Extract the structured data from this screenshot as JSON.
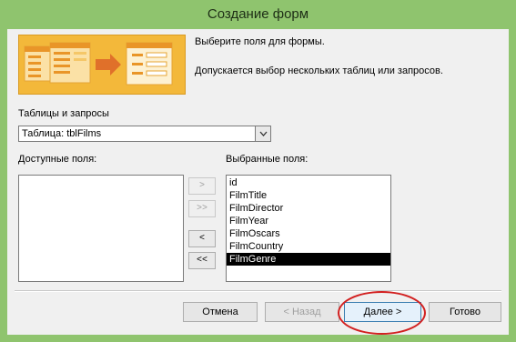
{
  "window": {
    "title": "Создание форм"
  },
  "intro": {
    "line1": "Выберите поля для формы.",
    "line2": "Допускается выбор нескольких таблиц или запросов."
  },
  "source": {
    "label": "Таблицы и запросы",
    "selected": "Таблица: tblFilms"
  },
  "available": {
    "label": "Доступные поля:",
    "items": []
  },
  "selected_fields": {
    "label": "Выбранные поля:",
    "items": [
      "id",
      "FilmTitle",
      "FilmDirector",
      "FilmYear",
      "FilmOscars",
      "FilmCountry",
      "FilmGenre"
    ],
    "highlighted": "FilmGenre"
  },
  "move_buttons": {
    "add_one": ">",
    "add_all": ">>",
    "remove_one": "<",
    "remove_all": "<<"
  },
  "footer": {
    "cancel": "Отмена",
    "back": "< Назад",
    "next": "Далее >",
    "finish": "Готово"
  },
  "colors": {
    "title_bar": "#8fc46e",
    "banner": "#f3b83a",
    "highlight_ring": "#d22020"
  }
}
